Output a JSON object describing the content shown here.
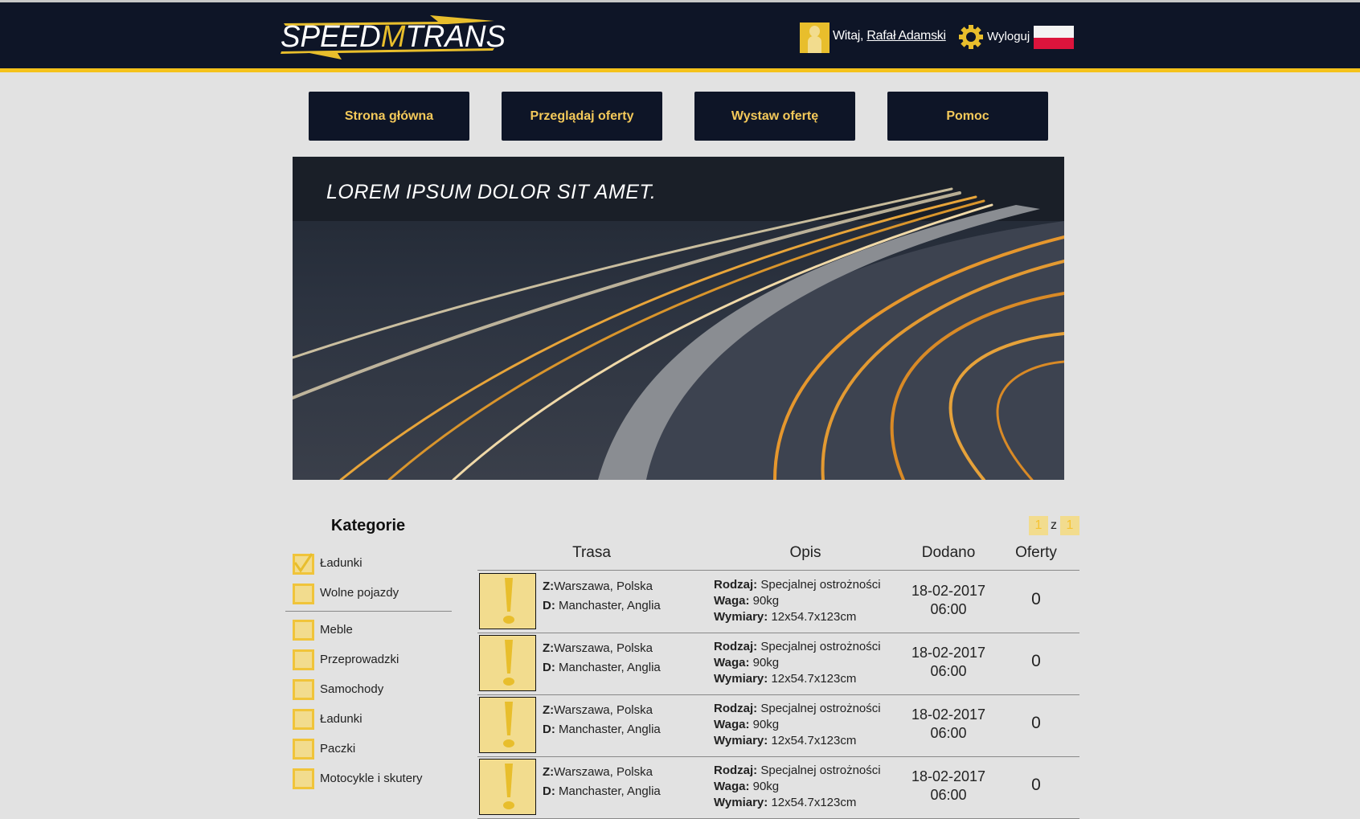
{
  "header": {
    "logo_text": "SPEEDMTRANS",
    "welcome": "Witaj,",
    "user_name": "Rafał Adamski",
    "logout": "Wyloguj",
    "icons": [
      "user-icon",
      "gear-icon",
      "flag-poland-icon"
    ],
    "accent": "#f4c21b",
    "background": "#0e1527"
  },
  "nav": [
    {
      "label": "Strona główna"
    },
    {
      "label": "Przeglądaj oferty"
    },
    {
      "label": "Wystaw ofertę"
    },
    {
      "label": "Pomoc"
    }
  ],
  "banner": {
    "text": "LOREM IPSUM DOLOR SIT AMET."
  },
  "categories": {
    "title": "Kategorie",
    "primary": [
      {
        "label": "Ładunki",
        "checked": true
      },
      {
        "label": "Wolne pojazdy",
        "checked": false
      }
    ],
    "items": [
      {
        "label": "Meble",
        "checked": false
      },
      {
        "label": "Przeprowadzki",
        "checked": false
      },
      {
        "label": "Samochody",
        "checked": false
      },
      {
        "label": "Ładunki",
        "checked": false
      },
      {
        "label": "Paczki",
        "checked": false
      },
      {
        "label": "Motocykle i skutery",
        "checked": false
      }
    ]
  },
  "pagination": {
    "current": "1",
    "sep": "z",
    "total": "1"
  },
  "table": {
    "headers": [
      "Trasa",
      "Opis",
      "Dodano",
      "Oferty"
    ],
    "rows": [
      {
        "from_label": "Z:",
        "from": "Warszawa, Polska",
        "to_label": "D:",
        "to": "Manchaster, Anglia",
        "type_label": "Rodzaj:",
        "type": "Specjalnej ostrożności",
        "weight_label": "Waga:",
        "weight": "90kg",
        "dim_label": "Wymiary:",
        "dim": "12x54.7x123cm",
        "date": "18-02-2017",
        "time": "06:00",
        "offers": "0"
      },
      {
        "from_label": "Z:",
        "from": "Warszawa, Polska",
        "to_label": "D:",
        "to": "Manchaster, Anglia",
        "type_label": "Rodzaj:",
        "type": "Specjalnej ostrożności",
        "weight_label": "Waga:",
        "weight": "90kg",
        "dim_label": "Wymiary:",
        "dim": "12x54.7x123cm",
        "date": "18-02-2017",
        "time": "06:00",
        "offers": "0"
      },
      {
        "from_label": "Z:",
        "from": "Warszawa, Polska",
        "to_label": "D:",
        "to": "Manchaster, Anglia",
        "type_label": "Rodzaj:",
        "type": "Specjalnej ostrożności",
        "weight_label": "Waga:",
        "weight": "90kg",
        "dim_label": "Wymiary:",
        "dim": "12x54.7x123cm",
        "date": "18-02-2017",
        "time": "06:00",
        "offers": "0"
      },
      {
        "from_label": "Z:",
        "from": "Warszawa, Polska",
        "to_label": "D:",
        "to": "Manchaster, Anglia",
        "type_label": "Rodzaj:",
        "type": "Specjalnej ostrożności",
        "weight_label": "Waga:",
        "weight": "90kg",
        "dim_label": "Wymiary:",
        "dim": "12x54.7x123cm",
        "date": "18-02-2017",
        "time": "06:00",
        "offers": "0"
      }
    ]
  }
}
